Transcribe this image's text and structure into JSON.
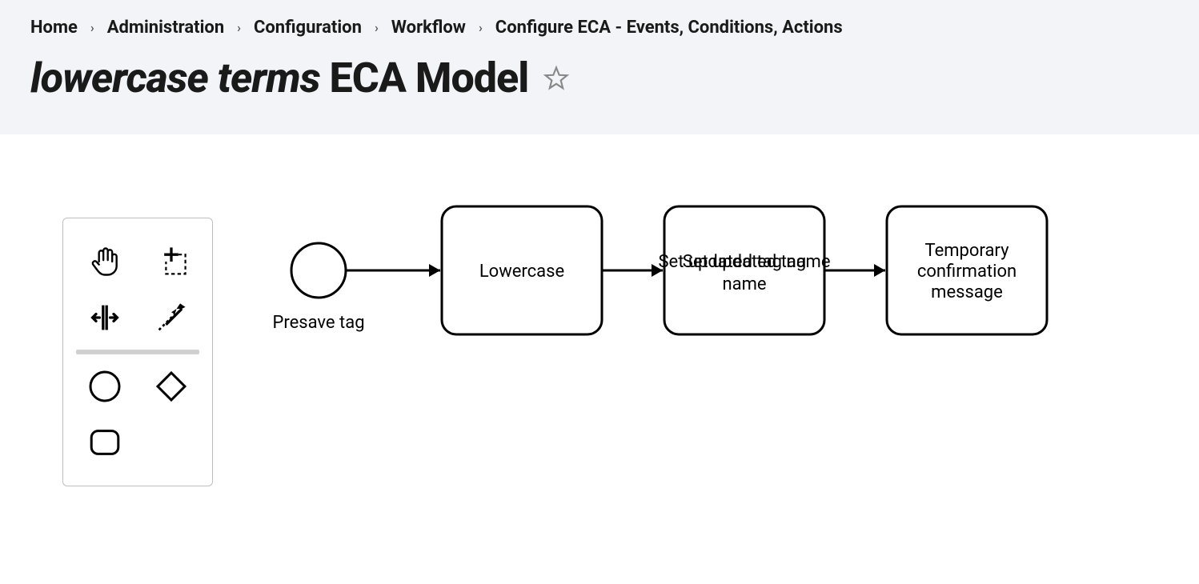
{
  "breadcrumb": {
    "items": [
      {
        "label": "Home"
      },
      {
        "label": "Administration"
      },
      {
        "label": "Configuration"
      },
      {
        "label": "Workflow"
      },
      {
        "label": "Configure ECA - Events, Conditions, Actions"
      }
    ]
  },
  "title": {
    "prefix_italic": "lowercase terms",
    "suffix": " ECA Model"
  },
  "palette": {
    "tools": [
      {
        "name": "hand-tool"
      },
      {
        "name": "lasso-tool"
      },
      {
        "name": "space-tool"
      },
      {
        "name": "global-connect-tool"
      },
      {
        "name": "create-start-event"
      },
      {
        "name": "create-gateway"
      },
      {
        "name": "create-task"
      }
    ]
  },
  "diagram": {
    "event": {
      "label": "Presave tag"
    },
    "tasks": [
      {
        "label": "Lowercase"
      },
      {
        "label": "Set updated tag name"
      },
      {
        "label": "Temporary confirmation message"
      }
    ]
  }
}
